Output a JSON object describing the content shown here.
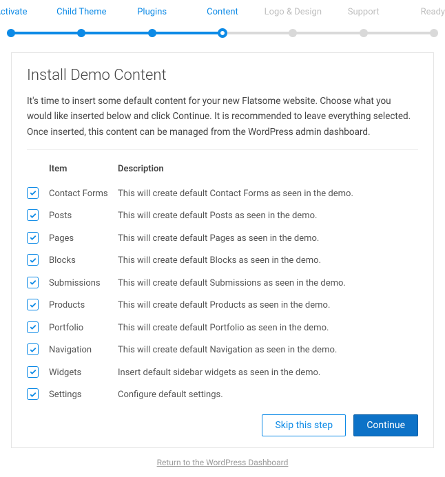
{
  "stepper": {
    "steps": [
      {
        "label": "Activate",
        "state": "done"
      },
      {
        "label": "Child Theme",
        "state": "done"
      },
      {
        "label": "Plugins",
        "state": "done"
      },
      {
        "label": "Content",
        "state": "active"
      },
      {
        "label": "Logo & Design",
        "state": "todo"
      },
      {
        "label": "Support",
        "state": "todo"
      },
      {
        "label": "Ready!",
        "state": "todo"
      }
    ]
  },
  "page": {
    "title": "Install Demo Content",
    "description": "It's time to insert some default content for your new Flatsome website. Choose what you would like inserted below and click Continue. It is recommended to leave everything selected. Once inserted, this content can be managed from the WordPress admin dashboard."
  },
  "table": {
    "headers": {
      "item": "Item",
      "description": "Description"
    }
  },
  "items": [
    {
      "checked": true,
      "name": "Contact Forms",
      "description": "This will create default Contact Forms as seen in the demo."
    },
    {
      "checked": true,
      "name": "Posts",
      "description": "This will create default Posts as seen in the demo."
    },
    {
      "checked": true,
      "name": "Pages",
      "description": "This will create default Pages as seen in the demo."
    },
    {
      "checked": true,
      "name": "Blocks",
      "description": "This will create default Blocks as seen in the demo."
    },
    {
      "checked": true,
      "name": "Submissions",
      "description": "This will create default Submissions as seen in the demo."
    },
    {
      "checked": true,
      "name": "Products",
      "description": "This will create default Products as seen in the demo."
    },
    {
      "checked": true,
      "name": "Portfolio",
      "description": "This will create default Portfolio as seen in the demo."
    },
    {
      "checked": true,
      "name": "Navigation",
      "description": "This will create default Navigation as seen in the demo."
    },
    {
      "checked": true,
      "name": "Widgets",
      "description": "Insert default sidebar widgets as seen in the demo."
    },
    {
      "checked": true,
      "name": "Settings",
      "description": "Configure default settings."
    }
  ],
  "actions": {
    "skip": "Skip this step",
    "continue": "Continue"
  },
  "footer": {
    "return_link": "Return to the WordPress Dashboard"
  },
  "colors": {
    "accent": "#0d8ae6",
    "primary_button": "#0d72c7"
  }
}
